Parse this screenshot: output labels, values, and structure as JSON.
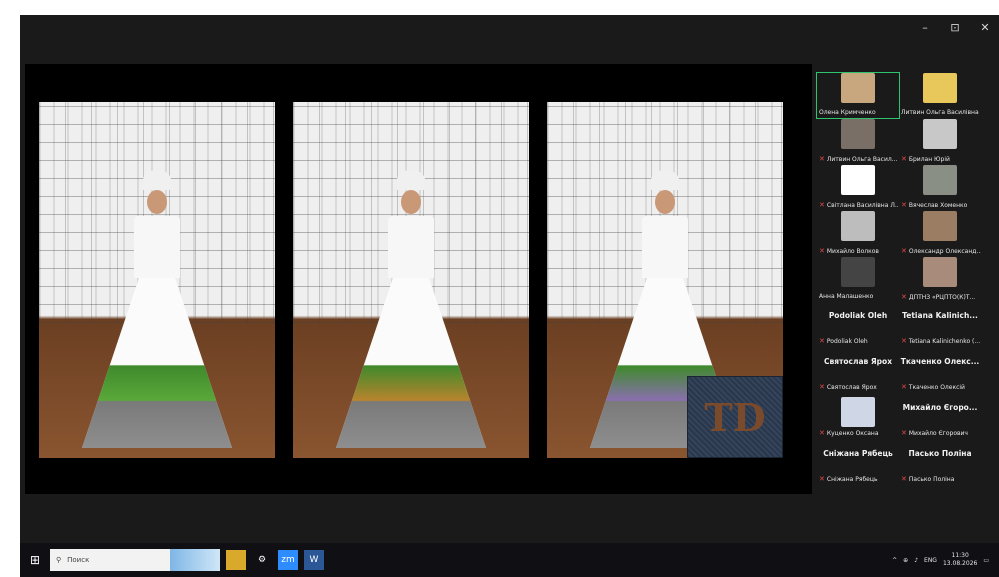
{
  "window_controls": {
    "minimize": "–",
    "restore": "⊡",
    "close": "✕"
  },
  "shared_screen": {
    "logo_text": "TD"
  },
  "participants": [
    {
      "name": "Олена Кримченко",
      "muted": false,
      "active": true,
      "thumb_color": "#c9a77e"
    },
    {
      "name": "Литвин Ольга Василівна",
      "muted": false,
      "active": false,
      "thumb_color": "#e8c85a"
    },
    {
      "name": "Литвин Ольга Васил...",
      "muted": true,
      "active": false,
      "thumb_color": "#7a6f66"
    },
    {
      "name": "Брилан Юрій",
      "muted": true,
      "active": false,
      "thumb_color": "#c8c8c8"
    },
    {
      "name": "Світлана Василівна Л...",
      "muted": true,
      "active": false,
      "thumb_color": "#ffffff"
    },
    {
      "name": "Вячеслав Хоменко",
      "muted": true,
      "active": false,
      "thumb_color": "#8a8f85"
    },
    {
      "name": "Михайло Волков",
      "muted": true,
      "active": false,
      "thumb_color": "#bdbdbd"
    },
    {
      "name": "Олександр Олександ...",
      "muted": true,
      "active": false,
      "thumb_color": "#9a7d63"
    },
    {
      "name": "Анна Малашенко",
      "muted": false,
      "active": false,
      "thumb_color": "#444444"
    },
    {
      "name": "ДПТНЗ «РЦПТО(К)Т...",
      "muted": true,
      "active": false,
      "thumb_color": "#a88b7a"
    }
  ],
  "name_only_participants": [
    {
      "big": "Podoliak Oleh",
      "name": "Podoliak Oleh"
    },
    {
      "big": "Tetiana Kalinich...",
      "name": "Tetiana Kalinichenko (..."
    },
    {
      "big": "Святослав Ярох",
      "name": "Святослав Ярох"
    },
    {
      "big": "Ткаченко Олекс...",
      "name": "Ткаченко Олексій"
    },
    {
      "big": "",
      "name": "Куценко Оксана",
      "thumb": true
    },
    {
      "big": "Михайло Єгоро...",
      "name": "Михайло Єгорович"
    },
    {
      "big": "Сніжана Рябець",
      "name": "Сніжана Рябець"
    },
    {
      "big": "Пасько Поліна",
      "name": "Пасько Поліна"
    }
  ],
  "taskbar": {
    "search_placeholder": "Поиск",
    "lang": "ENG",
    "time": "11:30",
    "date": "13.08.2026"
  }
}
